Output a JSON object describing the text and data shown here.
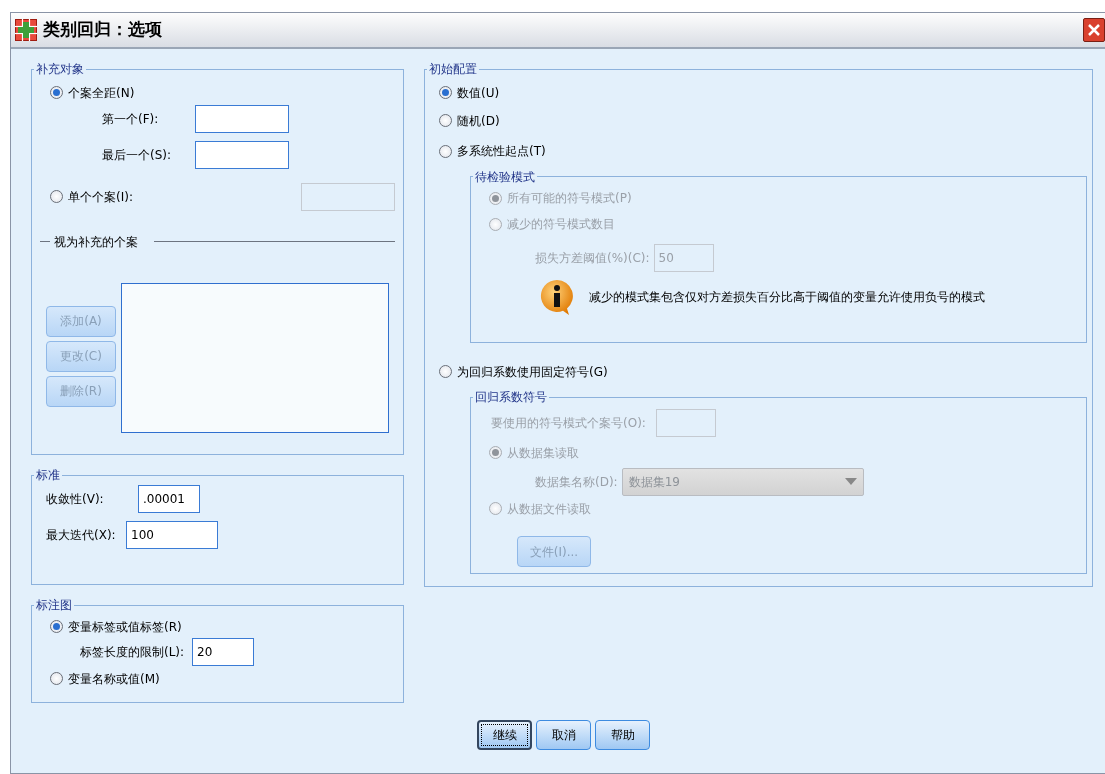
{
  "window": {
    "title": "类别回归：选项"
  },
  "supplementary_objects": {
    "legend": "补充对象",
    "range_option": {
      "label": "个案全距(N)",
      "selected": true
    },
    "first": {
      "label": "第一个(F):"
    },
    "last": {
      "label": "最后一个(S):"
    },
    "single_option": {
      "label": "单个个案(I):",
      "selected": false
    },
    "treated_heading": "视为补充的个案",
    "buttons": [
      {
        "label": "添加(A)",
        "disabled": true
      },
      {
        "label": "更改(C)",
        "disabled": true
      },
      {
        "label": "删除(R)",
        "disabled": true
      }
    ]
  },
  "criteria": {
    "legend": "标准",
    "fields": [
      {
        "label": "收敛性(V):",
        "value": ".00001",
        "kind": "short"
      },
      {
        "label": "最大迭代(X):",
        "value": "100",
        "kind": "long"
      }
    ]
  },
  "plot_labels": {
    "legend": "标注图",
    "options": [
      {
        "label": "变量标签或值标签(R)",
        "selected": true
      },
      {
        "label": "变量名称或值(M)",
        "selected": false
      }
    ],
    "limit": {
      "label": "标签长度的限制(L):",
      "value": "20"
    }
  },
  "initial_configuration": {
    "legend": "初始配置",
    "options": [
      {
        "label": "数值(U)",
        "selected": true
      },
      {
        "label": "随机(D)",
        "selected": false
      },
      {
        "label": "多系统性起点(T)",
        "selected": false
      },
      {
        "label": "为回归系数使用固定符号(G)",
        "selected": false
      }
    ],
    "patterns": {
      "legend": "待检验模式",
      "disabled": true,
      "options": [
        {
          "label": "所有可能的符号模式(P)",
          "selected": true
        },
        {
          "label": "减少的符号模式数目",
          "selected": false
        }
      ],
      "threshold": {
        "label": "损失方差阈值(%)(C):",
        "value": "50"
      },
      "info": "减少的模式集包含仅对方差损失百分比高于阈值的变量允许使用负号的模式"
    },
    "signs": {
      "legend": "回归系数符号",
      "disabled": true,
      "case_number": {
        "label": "要使用的符号模式个案号(O):"
      },
      "options": [
        {
          "label": "从数据集读取",
          "selected": true
        },
        {
          "label": "从数据文件读取",
          "selected": false
        }
      ],
      "dataset": {
        "label": "数据集名称(D):",
        "value": "数据集19"
      },
      "file_button": "文件(I)..."
    }
  },
  "buttons": [
    {
      "label": "继续",
      "focused": true
    },
    {
      "label": "取消",
      "focused": false
    },
    {
      "label": "帮助",
      "focused": false
    }
  ]
}
